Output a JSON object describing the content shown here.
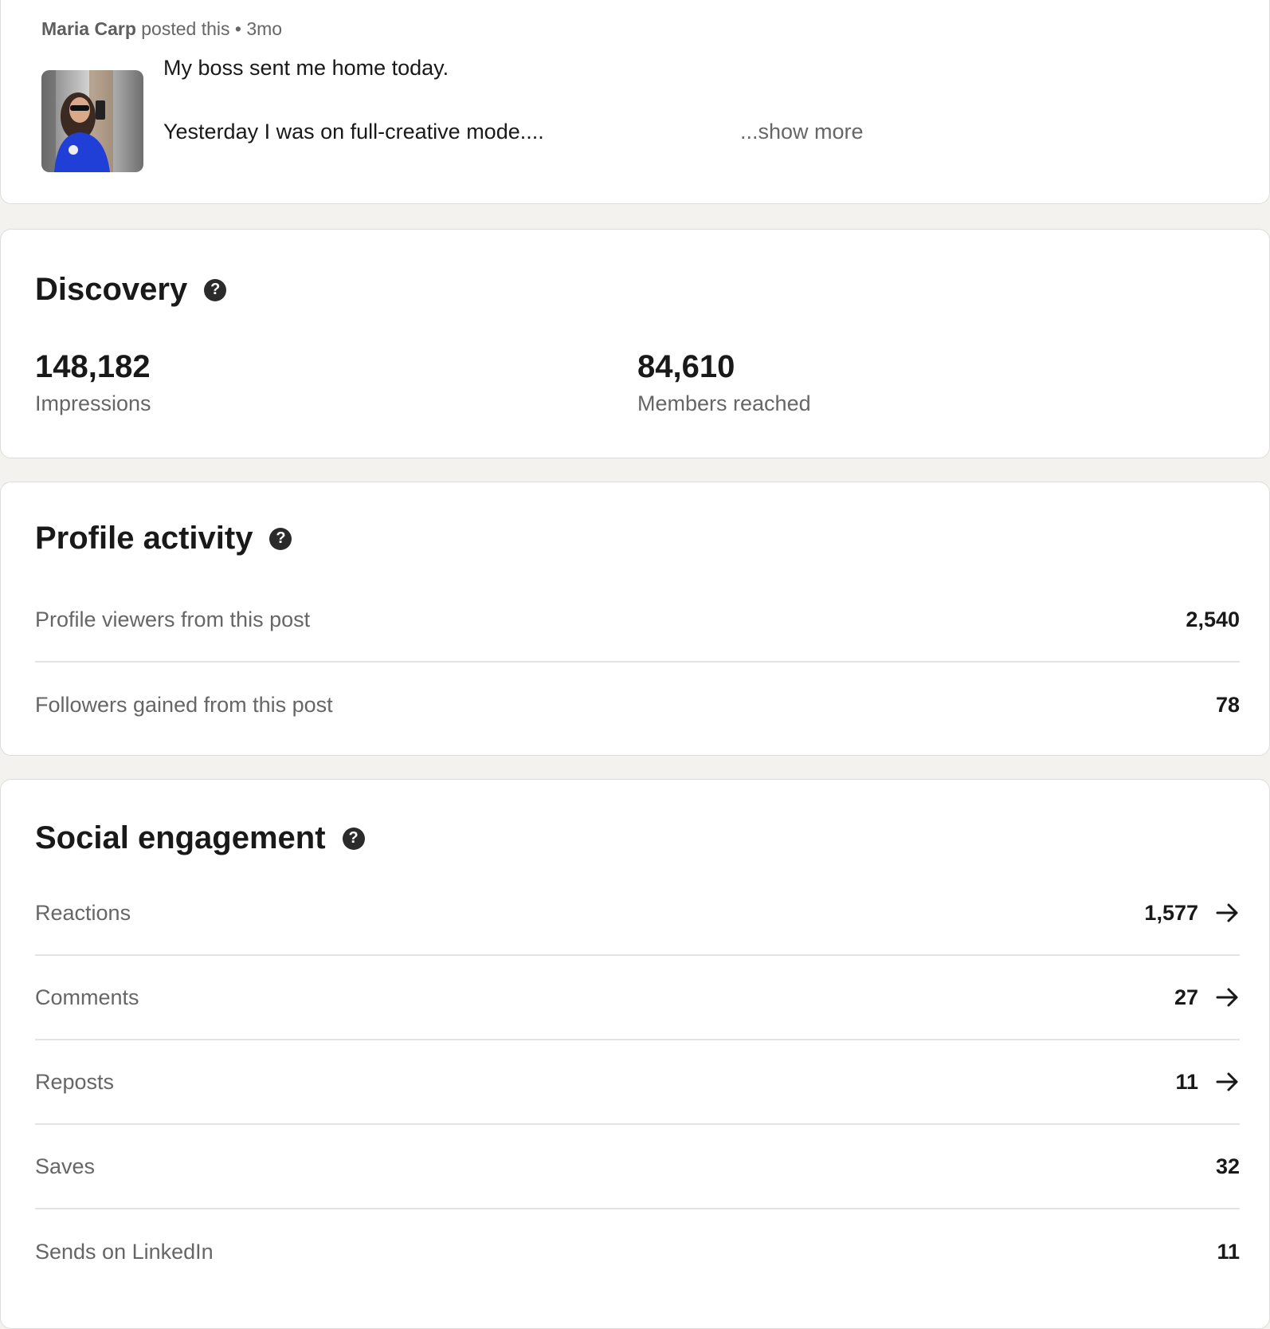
{
  "post": {
    "author": "Maria Carp",
    "posted_text": "posted this",
    "separator": "•",
    "age": "3mo",
    "line1": "My boss sent me home today.",
    "line2": "Yesterday I was on full-creative mode....",
    "show_more": "...show more"
  },
  "discovery": {
    "title": "Discovery",
    "impressions_value": "148,182",
    "impressions_label": "Impressions",
    "members_value": "84,610",
    "members_label": "Members reached"
  },
  "profile_activity": {
    "title": "Profile activity",
    "rows": [
      {
        "label": "Profile viewers from this post",
        "value": "2,540"
      },
      {
        "label": "Followers gained from this post",
        "value": "78"
      }
    ]
  },
  "social_engagement": {
    "title": "Social engagement",
    "rows": [
      {
        "label": "Reactions",
        "value": "1,577"
      },
      {
        "label": "Comments",
        "value": "27"
      },
      {
        "label": "Reposts",
        "value": "11"
      },
      {
        "label": "Saves",
        "value": "32"
      },
      {
        "label": "Sends on LinkedIn",
        "value": "11"
      }
    ]
  },
  "icons": {
    "help": "help-icon",
    "arrow": "arrow-right-icon"
  },
  "colors": {
    "background": "#f3f2ef",
    "card": "#ffffff",
    "text_primary": "#191919",
    "text_secondary": "#666666",
    "divider": "#e3e3e3"
  }
}
